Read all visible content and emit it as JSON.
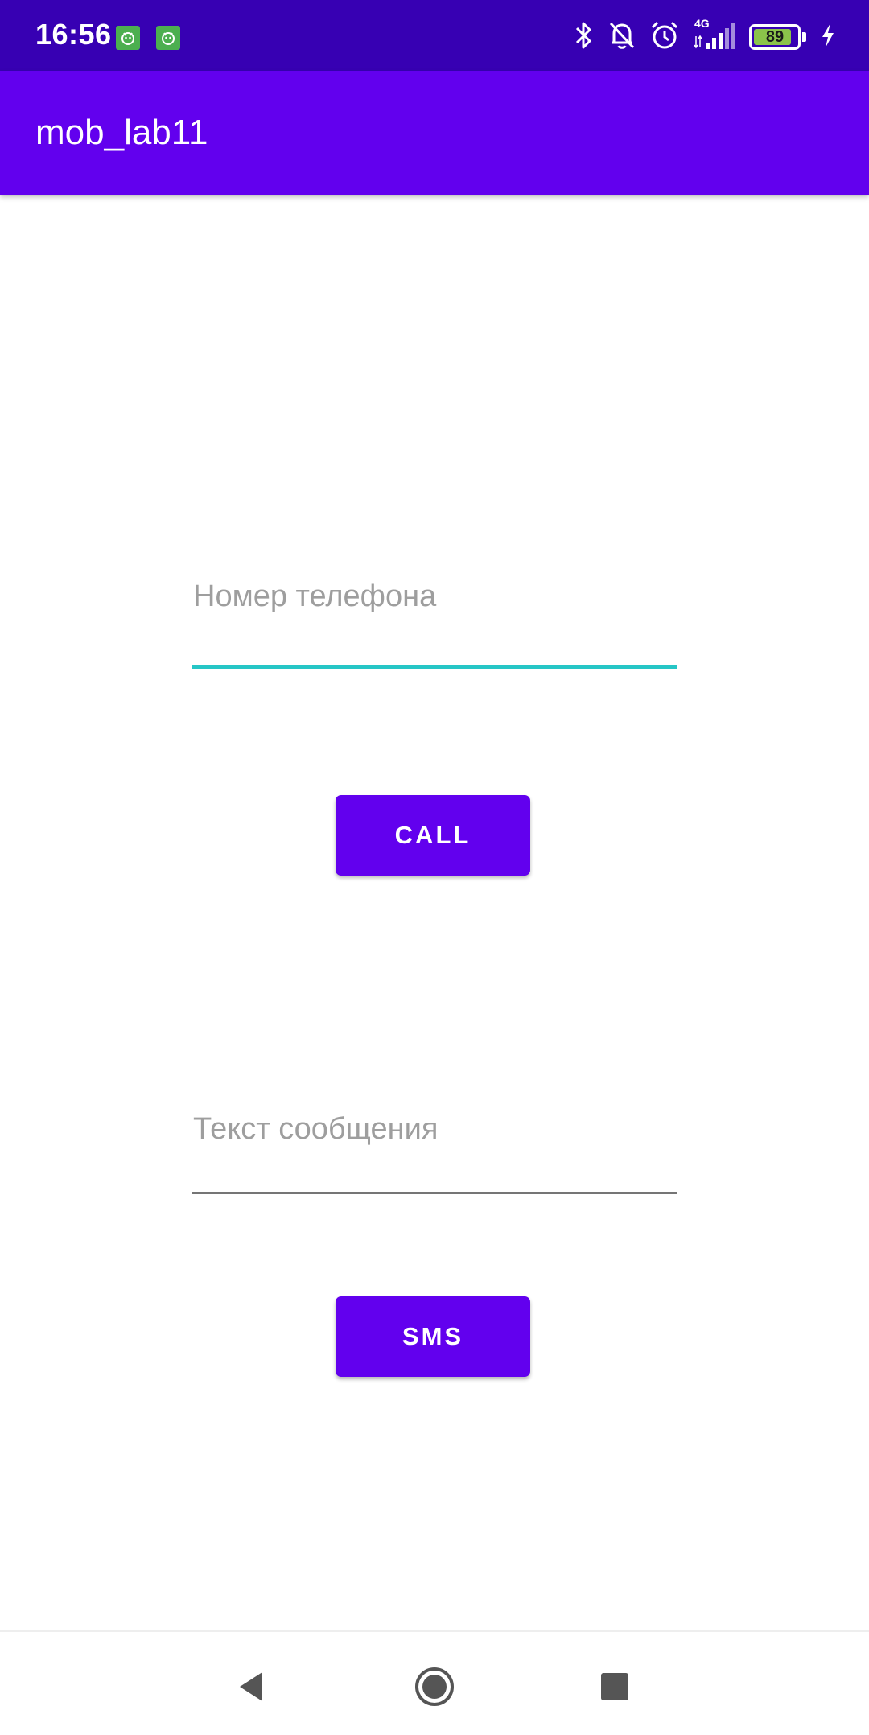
{
  "status_bar": {
    "time": "16:56",
    "battery_level": 89,
    "battery_text": "89",
    "network": "4G",
    "icons": [
      "notification-app-icon",
      "notification-app-icon",
      "bluetooth-icon",
      "bell-off-icon",
      "alarm-icon",
      "signal-icon",
      "battery-icon",
      "charging-icon"
    ]
  },
  "app_bar": {
    "title": "mob_lab11"
  },
  "main": {
    "phone_field": {
      "placeholder": "Номер телефона",
      "value": ""
    },
    "call_button": {
      "label": "CALL"
    },
    "message_field": {
      "placeholder": "Текст сообщения",
      "value": ""
    },
    "sms_button": {
      "label": "SMS"
    }
  },
  "nav_bar": {
    "icons": [
      "back-icon",
      "home-icon",
      "recents-icon"
    ]
  },
  "colors": {
    "status_bar": "#3700B3",
    "primary": "#6200EE",
    "focused_underline": "#26C6C6",
    "hint_text": "#9E9E9E"
  }
}
